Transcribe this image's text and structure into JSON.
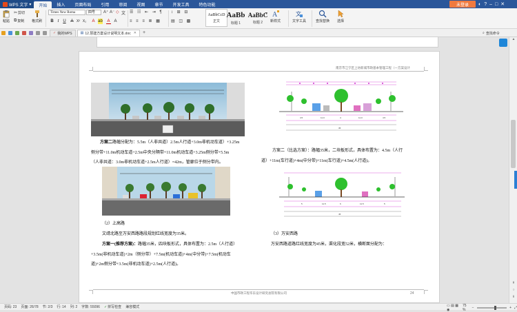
{
  "app": {
    "name": "WPS 文字",
    "menu_tabs": [
      "开始",
      "插入",
      "页面布局",
      "引用",
      "审阅",
      "视图",
      "章节",
      "开发工具",
      "特色功能"
    ],
    "login_label": "未登录"
  },
  "ribbon": {
    "paste_label": "粘贴",
    "cut_label": "剪切",
    "copy_label": "复制",
    "format_painter_label": "格式刷",
    "font_name": "Times New Roma",
    "font_size": "四号",
    "styles": [
      {
        "sample": "AaBbCcD",
        "name": "正文"
      },
      {
        "sample": "AaBb",
        "name": "标题 1"
      },
      {
        "sample": "AaBbC",
        "name": "标题 2"
      }
    ],
    "new_style_label": "新样式",
    "text_tools_label": "文字工具",
    "find_replace_label": "查找替换",
    "select_label": "选择"
  },
  "tabs": {
    "home_tab": "我的WPS",
    "doc_tab": "12.慧建方案设计说明文本.doc",
    "command_search": "查找命令"
  },
  "page": {
    "header_text": "南京市江宁区上坊新城市政基本管理工程（一方案设计",
    "footer_text": "中国市政工程华东设计研究总院有限公司",
    "page_number": "24",
    "left_paras": [
      {
        "bold": "方案二",
        "text": "路幅分配为：5.5m（人非共道）2.5m人行道+3.0m非机动车道）+3.25m"
      },
      {
        "bold": "",
        "text": "侧分带+11.0m机动车道+2.5m中央分隔带+11.0m机动车道+3.25m侧分带+5.5m"
      },
      {
        "bold": "",
        "text": "（人非共道：3.0m非机动车道+2.5m人行道）=42m，管廊位于侧分带内。"
      }
    ],
    "left_section2_title": "（2）上高路",
    "left_section2_paras": [
      {
        "bold": "",
        "text": "文靖北路至万安西路路段规划红线宽度为35米。"
      },
      {
        "bold": "方案一(推荐方案)：",
        "text": "路幅35米，四块板形式，具体布置为：2.5m（人行道）"
      },
      {
        "bold": "",
        "text": "+3.5m(非机动车道)+2m（侧分带）+7.5m(机动车道)+4m(中分带)+7.5m(机动车"
      },
      {
        "bold": "",
        "text": "道)+2m侧分带+3.5m(非机动车道)+2.5m(人行道)。"
      }
    ],
    "right_paras": [
      {
        "bold": "",
        "text": "方案二（比选方案）：路幅35米，二块板形式，具体布置为：4.5m（人行"
      },
      {
        "bold": "",
        "text": "道）+11m(车行道)+4m(中分带)+11m(车行道)+4.5m(人行道)。"
      }
    ],
    "right_section3_title": "（3）万安西路",
    "right_section3_para": "万安西路道路红线宽度为45米，渠化段宽52米，横断面分配为："
  },
  "status": {
    "page": "页码: 23",
    "pages": "页面: 26/78",
    "section": "节: 2/3",
    "row": "行: 14",
    "col": "列: 2",
    "words": "字数: 55096",
    "spell": "拼写检查",
    "mode": "兼容模式",
    "zoom": "75 %"
  },
  "colors": {
    "accent": "#2b579a",
    "login": "#f07a3f"
  }
}
